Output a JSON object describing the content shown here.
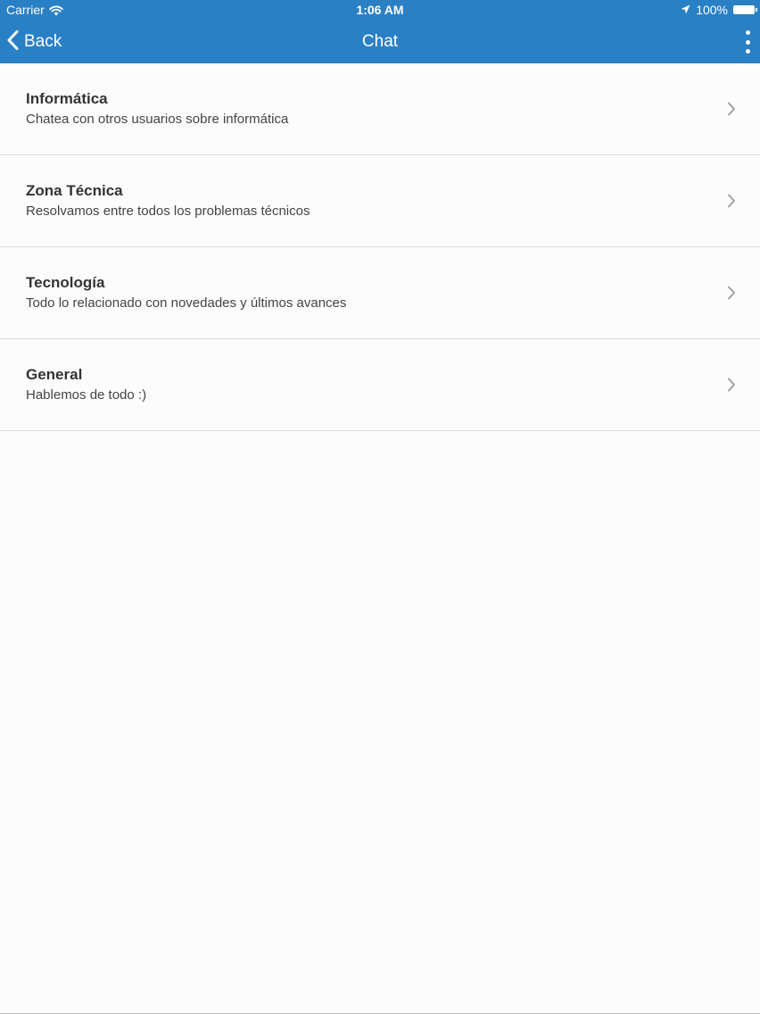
{
  "status_bar": {
    "carrier": "Carrier",
    "time": "1:06 AM",
    "battery": "100%"
  },
  "navbar": {
    "back_label": "Back",
    "title": "Chat",
    "icons": {
      "back": "chevron-left-icon",
      "more": "more-vertical-icon"
    },
    "bg_color": "#2a80c5"
  },
  "rooms": [
    {
      "title": "Informática",
      "subtitle": "Chatea con otros usuarios sobre informática"
    },
    {
      "title": "Zona Técnica",
      "subtitle": "Resolvamos entre todos los problemas técnicos"
    },
    {
      "title": "Tecnología",
      "subtitle": "Todo lo relacionado con novedades y últimos avances"
    },
    {
      "title": "General",
      "subtitle": "Hablemos de todo :)"
    }
  ]
}
